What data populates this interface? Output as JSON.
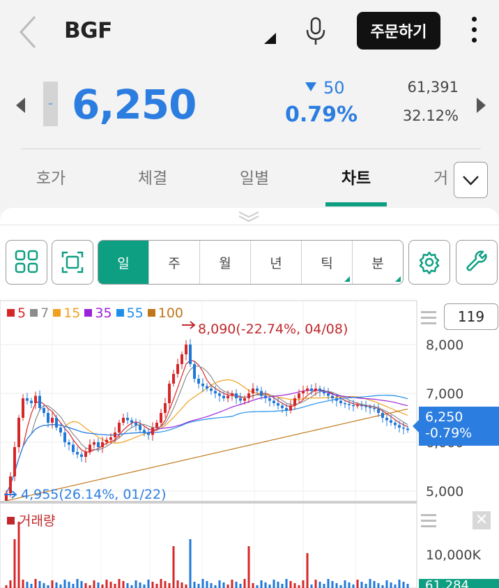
{
  "header": {
    "title": "BGF",
    "order_button": "주문하기"
  },
  "quote": {
    "price": "6,250",
    "change": "50",
    "change_pct": "0.79%",
    "flat_mark": "–",
    "volume": "61,391",
    "ratio": "32.12%",
    "price_color": "#2b7de0"
  },
  "tabs": [
    {
      "label": "호가"
    },
    {
      "label": "체결"
    },
    {
      "label": "일별"
    },
    {
      "label": "차트"
    },
    {
      "label": "거"
    }
  ],
  "toolbar": {
    "periods": [
      {
        "label": "일",
        "active": true
      },
      {
        "label": "주"
      },
      {
        "label": "월"
      },
      {
        "label": "년"
      },
      {
        "label": "틱",
        "submenu": true
      },
      {
        "label": "분",
        "submenu": true
      }
    ]
  },
  "chart": {
    "ma_legend": [
      {
        "label": "5",
        "color": "#d62728"
      },
      {
        "label": "7",
        "color": "#8c8c8c"
      },
      {
        "label": "15",
        "color": "#f0a020"
      },
      {
        "label": "35",
        "color": "#9b22d8"
      },
      {
        "label": "55",
        "color": "#1f8ee8"
      },
      {
        "label": "100",
        "color": "#c0761a"
      }
    ],
    "high_label": "8,090(-22.74%, 04/08)",
    "low_label": "4,955(26.14%, 01/22)",
    "candle_count": "119",
    "current_price_tag": "6,250",
    "current_pct_tag": "-0.79%",
    "volume_legend": "거래량",
    "volume_axis": "10,000K",
    "volume_tag": "61,284",
    "close_glyph": "✕"
  },
  "chart_data": {
    "type": "candlestick",
    "y_ticks": [
      "8,000",
      "7,000",
      "6,000",
      "5,000"
    ],
    "ylim": [
      4800,
      8300
    ],
    "high": 8090,
    "low": 4955,
    "last": 6250,
    "closes": [
      4955,
      5300,
      5900,
      6500,
      6900,
      6850,
      6800,
      6950,
      6700,
      6600,
      6400,
      6500,
      6300,
      6200,
      6000,
      5950,
      5800,
      5750,
      5700,
      5800,
      5950,
      6000,
      5900,
      6000,
      6050,
      6100,
      6200,
      6400,
      6500,
      6450,
      6400,
      6350,
      6250,
      6200,
      6150,
      6300,
      6400,
      6600,
      6800,
      7200,
      7400,
      7600,
      7800,
      8000,
      7600,
      7300,
      7200,
      7150,
      7100,
      7050,
      7000,
      6950,
      6900,
      6950,
      7000,
      6900,
      6850,
      6900,
      7000,
      7100,
      7050,
      6950,
      6900,
      6850,
      6800,
      6750,
      6700,
      6650,
      6750,
      6900,
      7000,
      7050,
      7100,
      7050,
      7100,
      7050,
      7000,
      6950,
      6900,
      6850,
      6800,
      6780,
      6760,
      6750,
      6760,
      6740,
      6720,
      6700,
      6680,
      6600,
      6500,
      6450,
      6400,
      6350,
      6300,
      6280,
      6250
    ]
  }
}
